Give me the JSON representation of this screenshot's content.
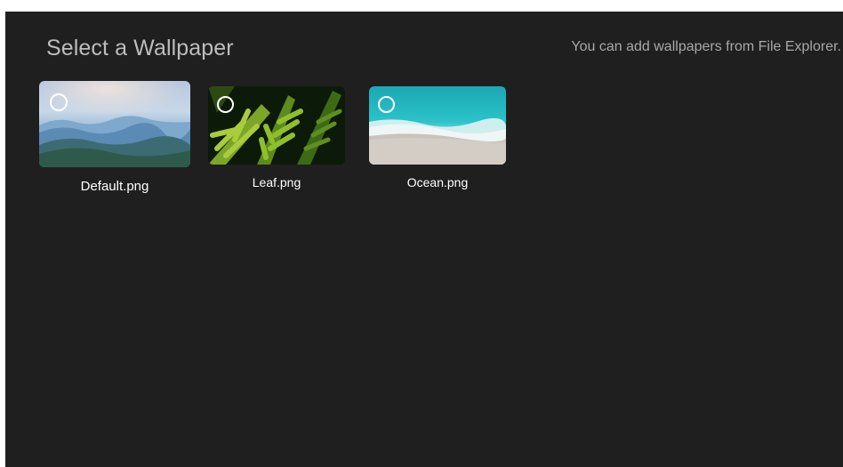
{
  "header": {
    "title": "Select a Wallpaper",
    "hint": "You can add wallpapers from File Explorer."
  },
  "wallpapers": [
    {
      "name": "Default.png",
      "icon": "mountain-landscape-image",
      "selected": false,
      "focused": true
    },
    {
      "name": "Leaf.png",
      "icon": "fern-leaf-image",
      "selected": false,
      "focused": false
    },
    {
      "name": "Ocean.png",
      "icon": "ocean-beach-image",
      "selected": false,
      "focused": false
    }
  ],
  "colors": {
    "background": "#1f1f1f",
    "title": "#bdbdbd",
    "hint": "#a8a8a8",
    "caption": "#ffffff"
  }
}
